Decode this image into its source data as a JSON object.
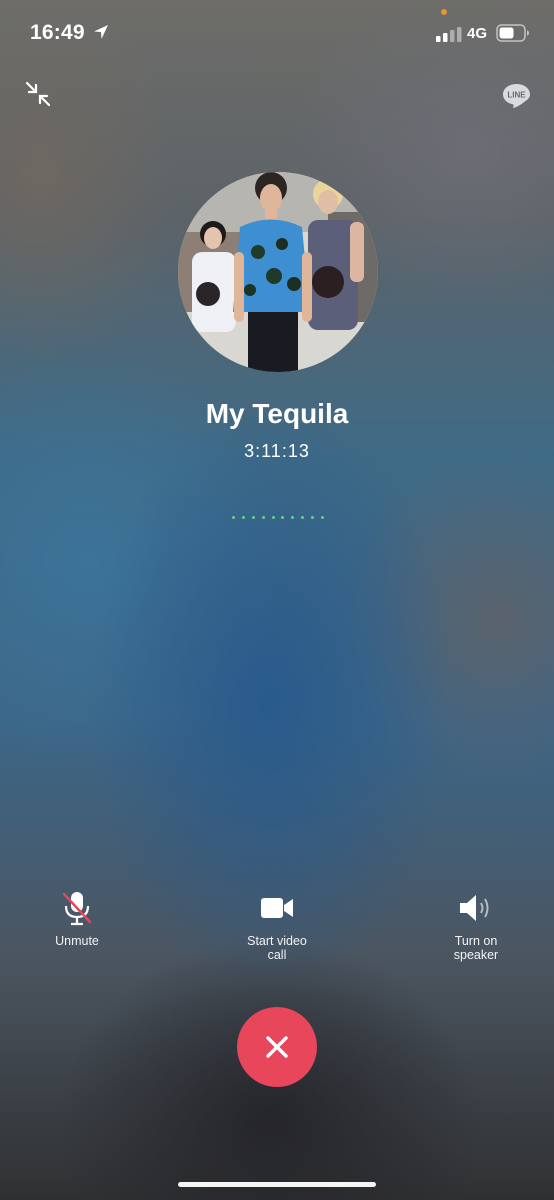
{
  "status_bar": {
    "time": "16:49",
    "network": "4G",
    "icons": [
      "location-arrow-icon",
      "signal-bars-icon",
      "battery-icon"
    ]
  },
  "header": {
    "minimize_icon": "collapse-arrows-icon",
    "brand_logo": "LINE"
  },
  "call": {
    "name": "My Tequila",
    "duration": "3:11:13",
    "indicator_dot_color": "#5fd38a"
  },
  "controls": {
    "mute_label": "Unmute",
    "video_label_line1": "Start video",
    "video_label_line2": "call",
    "speaker_label_line1": "Turn on",
    "speaker_label_line2": "speaker"
  },
  "end_call": {
    "icon": "close-x-icon",
    "color": "#e8465a"
  }
}
